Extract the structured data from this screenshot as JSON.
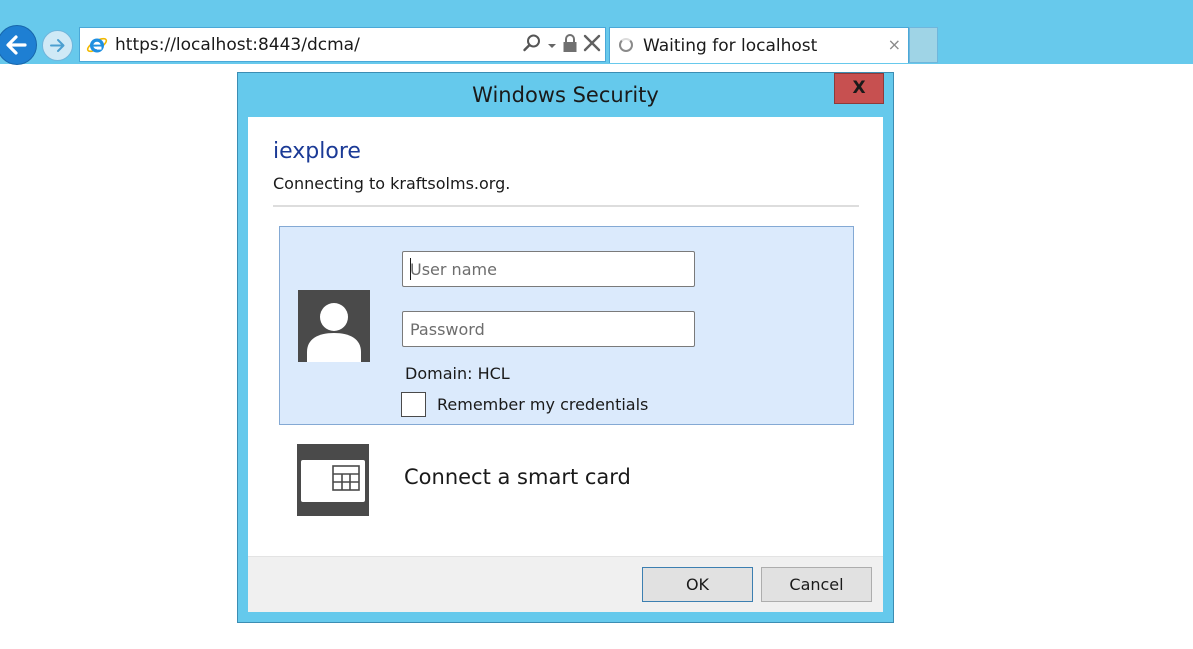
{
  "browser": {
    "address": "https://localhost:8443/dcma/",
    "tab_title": "Waiting for localhost",
    "tab_close": "×",
    "icons": {
      "back": "back-arrow-icon",
      "forward": "forward-arrow-icon",
      "site": "ie-logo-icon",
      "search": "search-icon",
      "dropdown": "chevron-down-icon",
      "lock": "lock-icon",
      "stop": "close-icon",
      "loading": "spinner-icon"
    },
    "colors": {
      "chrome": "#67c9ec",
      "back_button": "#1e7fd3"
    }
  },
  "dialog": {
    "title": "Windows Security",
    "close_label": "X",
    "app_name": "iexplore",
    "message": "Connecting to kraftsolms.org.",
    "username_placeholder": "User name",
    "username_value": "",
    "password_placeholder": "Password",
    "password_value": "",
    "domain": "Domain: HCL",
    "remember_label": "Remember my credentials",
    "remember_checked": false,
    "smartcard_label": "Connect a smart card",
    "ok_label": "OK",
    "cancel_label": "Cancel",
    "icons": {
      "user": "user-avatar-icon",
      "smartcard": "smart-card-icon"
    },
    "colors": {
      "frame": "#65c9ec",
      "close": "#c75050",
      "app_name": "#1b3a96",
      "panel": "#dbeafc"
    }
  }
}
